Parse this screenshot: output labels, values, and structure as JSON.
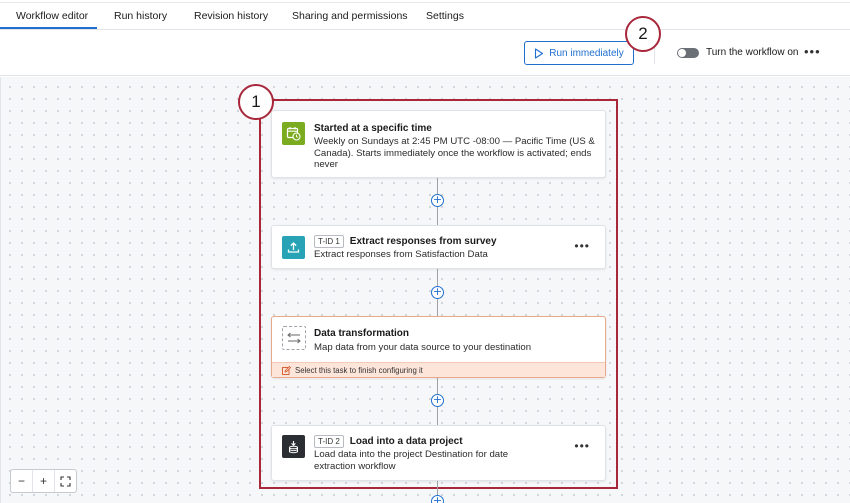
{
  "tabs": [
    {
      "label": "Workflow editor",
      "active": true
    },
    {
      "label": "Run history"
    },
    {
      "label": "Revision history"
    },
    {
      "label": "Sharing and permissions"
    },
    {
      "label": "Settings"
    }
  ],
  "toolbar": {
    "run_label": "Run immediately",
    "toggle_label": "Turn the workflow on",
    "toggle_on": false,
    "more_label": "•••"
  },
  "callouts": [
    "1",
    "2"
  ],
  "cards": [
    {
      "title": "Started at a specific time",
      "description": "Weekly on Sundays at 2:45 PM UTC -08:00 — Pacific Time (US & Canada). Starts immediately once the workflow is activated; ends never",
      "icon": "calendar-clock-icon",
      "icon_color": "#7bab1e"
    },
    {
      "tid": "T-ID 1",
      "title": "Extract responses from survey",
      "description": "Extract responses from Satisfaction Data",
      "icon": "upload-icon",
      "icon_color": "#27a3b5",
      "more": "•••"
    },
    {
      "title": "Data transformation",
      "description": "Map data from your data source to your destination",
      "icon": "transform-arrows-icon",
      "warning": "Select this task to finish configuring it"
    },
    {
      "tid": "T-ID 2",
      "title": "Load into a data project",
      "description": "Load data into the project Destination for date extraction workflow",
      "icon": "database-icon",
      "icon_color": "#2b2e33",
      "more": "•••"
    }
  ],
  "zoom": {
    "minus": "−",
    "plus": "+",
    "fit": "⛶"
  },
  "colors": {
    "accent": "#1f6fd1",
    "highlight": "#a8273a",
    "warning_bg": "#fde5da"
  }
}
